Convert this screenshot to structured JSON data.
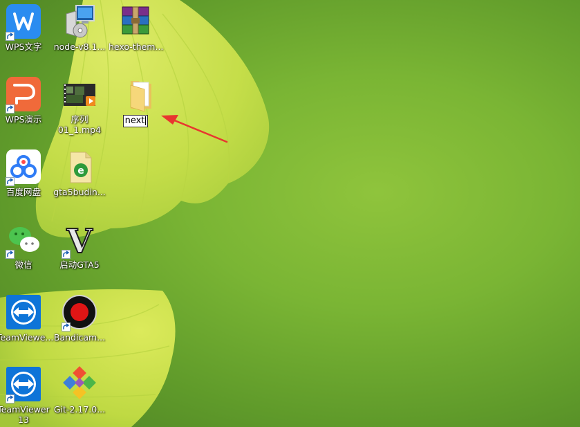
{
  "desktop": {
    "icons": {
      "wps_writer": {
        "label": "WPS文字"
      },
      "node": {
        "label": "node-v8.1..."
      },
      "hexo_theme": {
        "label": "hexo-them..."
      },
      "wps_presentation": {
        "label": "WPS演示"
      },
      "video": {
        "label_line1": "序列",
        "label_line2": "01_1.mp4"
      },
      "folder_next": {
        "rename_value": "next"
      },
      "baidu_pan": {
        "label": "百度网盘"
      },
      "gta5budin": {
        "label": "gta5budin..."
      },
      "wechat": {
        "label": "微信"
      },
      "gta5_launch": {
        "label": "启动GTA5"
      },
      "teamviewer": {
        "label": "TeamViewe..."
      },
      "bandicam": {
        "label": "Bandicam..."
      },
      "teamviewer13": {
        "label_line1": "TeamViewer",
        "label_line2": "13"
      },
      "git": {
        "label": "Git-2.17.0..."
      }
    },
    "annotation_color": "#e8362f",
    "wallpaper_colors": [
      "#7ab534",
      "#c6e04a"
    ]
  }
}
